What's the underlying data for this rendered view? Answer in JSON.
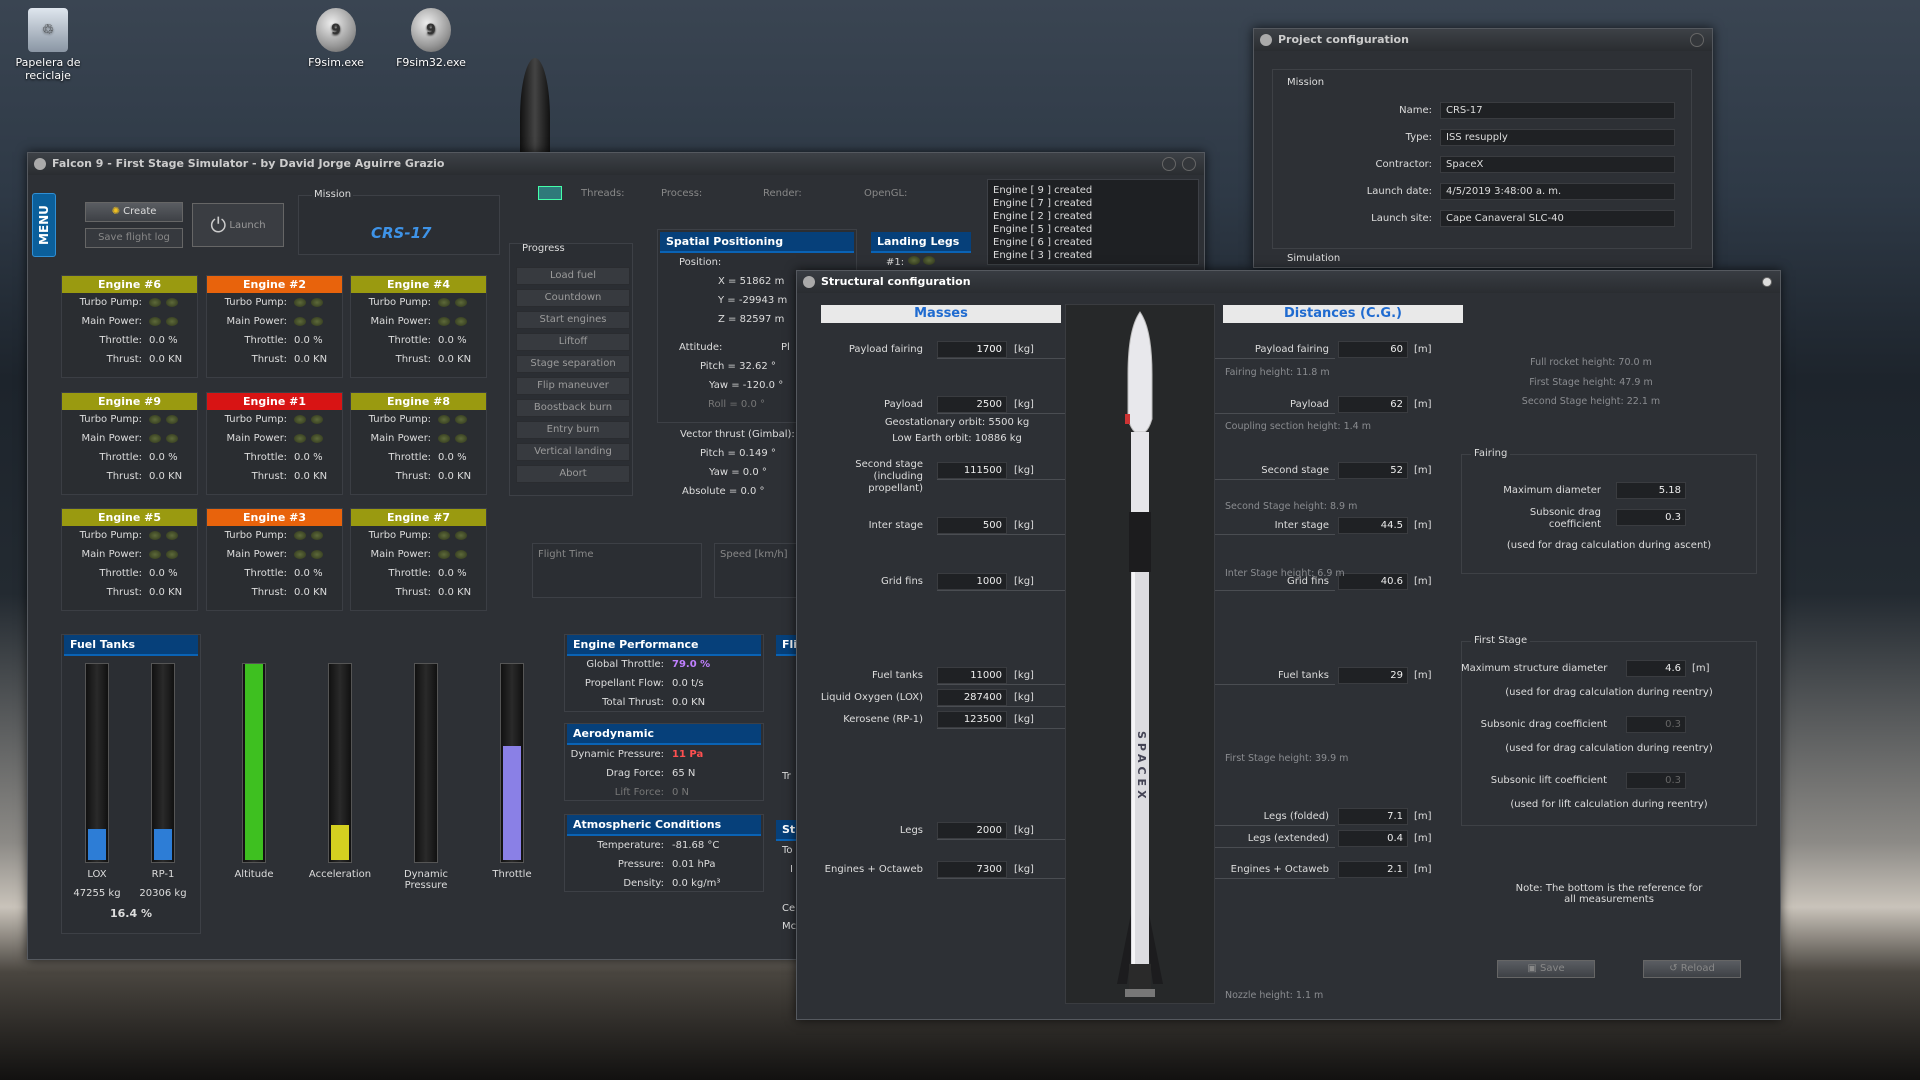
{
  "desktop": {
    "icons": [
      {
        "label": "Papelera de reciclaje"
      },
      {
        "label": "F9sim.exe"
      },
      {
        "label": "F9sim32.exe"
      }
    ]
  },
  "sim": {
    "title": "Falcon 9 - First Stage Simulator - by David Jorge Aguirre Grazio",
    "menu": "MENU",
    "create": "Create",
    "save_flight_log": "Save flight log",
    "launch": "Launch",
    "mission_label": "Mission",
    "mission_name": "CRS-17",
    "stats": {
      "threads": "Threads:",
      "process": "Process:",
      "render": "Render:",
      "opengl": "OpenGL:"
    },
    "log": [
      "Engine [ 9 ] created",
      "Engine [ 7 ] created",
      "Engine [ 2 ] created",
      "Engine [ 5 ] created",
      "Engine [ 6 ] created",
      "Engine [ 3 ] created"
    ],
    "engine_labels": {
      "turbo": "Turbo Pump:",
      "main": "Main Power:",
      "throttle": "Throttle:",
      "thrust": "Thrust:"
    },
    "engines": [
      {
        "name": "Engine #6",
        "color": "#9a9a10",
        "throttle": "0.0 %",
        "thrust": "0.0 KN"
      },
      {
        "name": "Engine #2",
        "color": "#e8630c",
        "throttle": "0.0 %",
        "thrust": "0.0 KN"
      },
      {
        "name": "Engine #4",
        "color": "#9a9a10",
        "throttle": "0.0 %",
        "thrust": "0.0 KN"
      },
      {
        "name": "Engine #9",
        "color": "#9a9a10",
        "throttle": "0.0 %",
        "thrust": "0.0 KN"
      },
      {
        "name": "Engine #1",
        "color": "#d81414",
        "throttle": "0.0 %",
        "thrust": "0.0 KN"
      },
      {
        "name": "Engine #8",
        "color": "#9a9a10",
        "throttle": "0.0 %",
        "thrust": "0.0 KN"
      },
      {
        "name": "Engine #5",
        "color": "#9a9a10",
        "throttle": "0.0 %",
        "thrust": "0.0 KN"
      },
      {
        "name": "Engine #3",
        "color": "#e8630c",
        "throttle": "0.0 %",
        "thrust": "0.0 KN"
      },
      {
        "name": "Engine #7",
        "color": "#9a9a10",
        "throttle": "0.0 %",
        "thrust": "0.0 KN"
      }
    ],
    "progress": {
      "title": "Progress",
      "steps": [
        "Load fuel",
        "Countdown",
        "Start engines",
        "Liftoff",
        "Stage separation",
        "Flip maneuver",
        "Boostback burn",
        "Entry burn",
        "Vertical landing",
        "Abort"
      ]
    },
    "spatial": {
      "title": "Spatial Positioning",
      "position": "Position:",
      "x": "X =  51862 m",
      "y": "Y =  -29943 m",
      "z": "Z =  82597 m",
      "attitude": "Attitude:",
      "pitch": "Pitch =  32.62 °",
      "yaw": "Yaw =  -120.0 °",
      "roll": "Roll =  0.0 °",
      "vector": "Vector thrust (Gimbal):",
      "vpitch": "Pitch =  0.149 °",
      "vyaw": "Yaw =  0.0 °",
      "vabs": "Absolute =  0.0 °",
      "pl": "Pl"
    },
    "legs": {
      "title": "Landing Legs",
      "item": "#1:"
    },
    "flight_time": "Flight Time",
    "speed": "Speed [km/h]",
    "fuel": {
      "title": "Fuel Tanks",
      "lox": "LOX",
      "lox_kg": "47255 kg",
      "rp1": "RP-1",
      "rp1_kg": "20306 kg",
      "percent": "16.4 %",
      "altitude": "Altitude",
      "acceleration": "Acceleration",
      "dynpress": "Dynamic Pressure",
      "throttle": "Throttle",
      "levels": {
        "lox": 0.16,
        "rp1": 0.16,
        "altitude": 1.0,
        "acceleration": 0.18,
        "dynpress": 0.0,
        "throttle": 0.58
      }
    },
    "perf": {
      "title": "Engine Performance",
      "gt_l": "Global Throttle:",
      "gt_v": "79.0 %",
      "pf_l": "Propellant Flow:",
      "pf_v": "0.0 t/s",
      "tt_l": "Total Thrust:",
      "tt_v": "0.0 KN"
    },
    "aero": {
      "title": "Aerodynamic",
      "dp_l": "Dynamic Pressure:",
      "dp_v": "11 Pa",
      "df_l": "Drag Force:",
      "df_v": "65 N",
      "lf_l": "Lift Force:",
      "lf_v": "0 N"
    },
    "atmo": {
      "title": "Atmospheric Conditions",
      "t_l": "Temperature:",
      "t_v": "-81.68 °C",
      "p_l": "Pressure:",
      "p_v": "0.01 hPa",
      "d_l": "Density:",
      "d_v": "0.0 kg/m³"
    },
    "cut": {
      "fli": "Fli",
      "tr": "Tr",
      "st": "St",
      "to": "To",
      "ce": "Ce",
      "mc": "Mc",
      "i": "I"
    }
  },
  "proj": {
    "title": "Project configuration",
    "mission": "Mission",
    "name_l": "Name:",
    "name_v": "CRS-17",
    "type_l": "Type:",
    "type_v": "ISS resupply",
    "contractor_l": "Contractor:",
    "contractor_v": "SpaceX",
    "date_l": "Launch date:",
    "date_v": "4/5/2019 3:48:00 a. m.",
    "site_l": "Launch site:",
    "site_v": "Cape Canaveral SLC-40",
    "simulation": "Simulation"
  },
  "struct": {
    "title": "Structural configuration",
    "masses": "Masses",
    "distances": "Distances (C.G.)",
    "kg": "[kg]",
    "m": "[m]",
    "mass_rows": [
      {
        "label": "Payload fairing",
        "value": "1700"
      },
      {
        "label": "Payload",
        "value": "2500"
      },
      {
        "label": "Second stage\n(including propellant)",
        "value": "111500"
      },
      {
        "label": "Inter stage",
        "value": "500"
      },
      {
        "label": "Grid fins",
        "value": "1000"
      },
      {
        "label": "Fuel tanks",
        "value": "11000"
      },
      {
        "label": "Liquid Oxygen (LOX)",
        "value": "287400"
      },
      {
        "label": "Kerosene (RP-1)",
        "value": "123500"
      },
      {
        "label": "Legs",
        "value": "2000"
      },
      {
        "label": "Engines + Octaweb",
        "value": "7300"
      }
    ],
    "geo": "Geostationary orbit: 5500 kg",
    "leo": "Low Earth orbit: 10886 kg",
    "dist_rows": [
      {
        "label": "Payload fairing",
        "value": "60"
      },
      {
        "label": "Payload",
        "value": "62"
      },
      {
        "label": "Second stage",
        "value": "52"
      },
      {
        "label": "Inter stage",
        "value": "44.5"
      },
      {
        "label": "Grid fins",
        "value": "40.6"
      },
      {
        "label": "Fuel tanks",
        "value": "29"
      },
      {
        "label": "Legs (folded)",
        "value": "7.1"
      },
      {
        "label": "Legs (extended)",
        "value": "0.4"
      },
      {
        "label": "Engines + Octaweb",
        "value": "2.1"
      }
    ],
    "notes": {
      "fairing_h": "Fairing height: 11.8 m",
      "coupling_h": "Coupling section height: 1.4 m",
      "ss_h": "Second Stage height: 8.9 m",
      "is_h": "Inter Stage height: 6.9 m",
      "fs_h": "First Stage height: 39.9 m",
      "nozzle_h": "Nozzle height: 1.1 m"
    },
    "heights": {
      "full": "Full rocket height: 70.0 m",
      "first": "First Stage height: 47.9 m",
      "second": "Second Stage height: 22.1 m"
    },
    "fairing": {
      "title": "Fairing",
      "maxd_l": "Maximum diameter",
      "maxd_v": "5.18",
      "sdc_l": "Subsonic drag\ncoefficient",
      "sdc_v": "0.3",
      "note": "(used for drag calculation during ascent)"
    },
    "first": {
      "title": "First Stage",
      "msd_l": "Maximum structure diameter",
      "msd_v": "4.6",
      "note1": "(used for drag calculation during reentry)",
      "sdc_l": "Subsonic drag coefficient",
      "sdc_v": "0.3",
      "note2": "(used for drag calculation during reentry)",
      "slc_l": "Subsonic lift coefficient",
      "slc_v": "0.3",
      "note3": "(used for lift calculation during reentry)"
    },
    "bottom_note": "Note: The bottom is the reference for all measurements",
    "save": "Save",
    "reload": "Reload",
    "rocket_text": "SPACEX"
  }
}
